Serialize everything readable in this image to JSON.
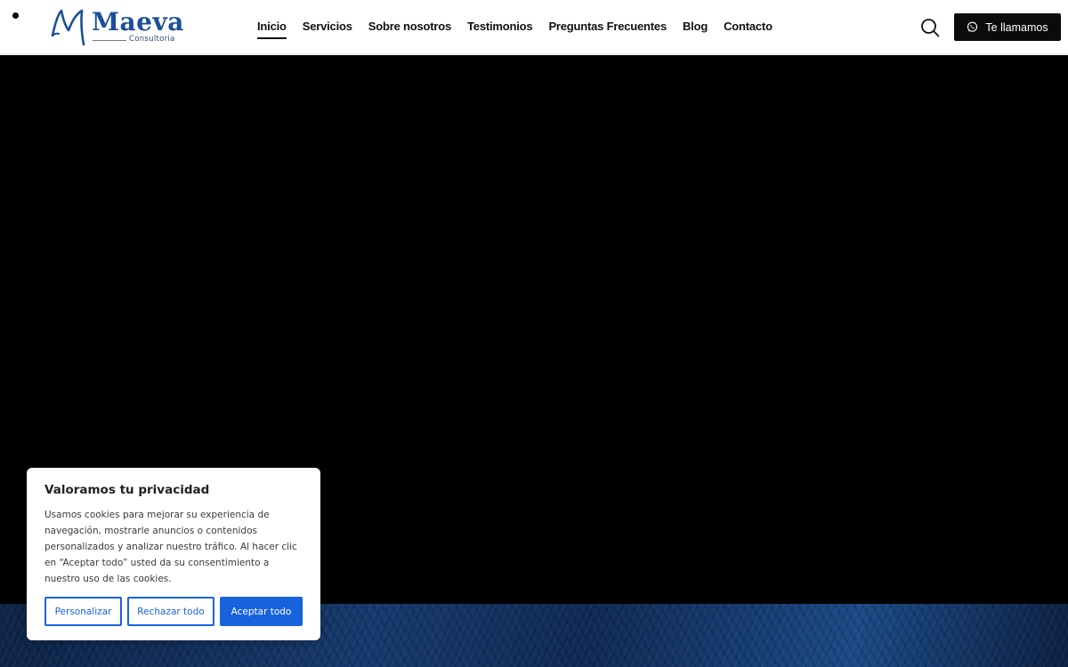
{
  "header": {
    "logo": {
      "word": "Maeva",
      "sub": "Consultoria",
      "color": "#1c4f9a"
    },
    "nav": [
      {
        "label": "Inicio",
        "active": true
      },
      {
        "label": "Servicios",
        "active": false
      },
      {
        "label": "Sobre nosotros",
        "active": false
      },
      {
        "label": "Testimonios",
        "active": false
      },
      {
        "label": "Preguntas Frecuentes",
        "active": false
      },
      {
        "label": "Blog",
        "active": false
      },
      {
        "label": "Contacto",
        "active": false
      }
    ],
    "search_icon": "search-icon",
    "call_button": {
      "label": "Te llamamos",
      "icon": "whatsapp-icon"
    }
  },
  "hero": {
    "background": "#000000"
  },
  "cookie_banner": {
    "title": "Valoramos tu privacidad",
    "text": "Usamos cookies para mejorar su experiencia de navegación, mostrarle anuncios o contenidos personalizados y analizar nuestro tráfico. Al hacer clic en “Aceptar todo” usted da su consentimiento a nuestro uso de las cookies.",
    "buttons": {
      "customize": "Personalizar",
      "reject": "Rechazar todo",
      "accept": "Aceptar todo"
    },
    "accent": "#1863dc"
  }
}
